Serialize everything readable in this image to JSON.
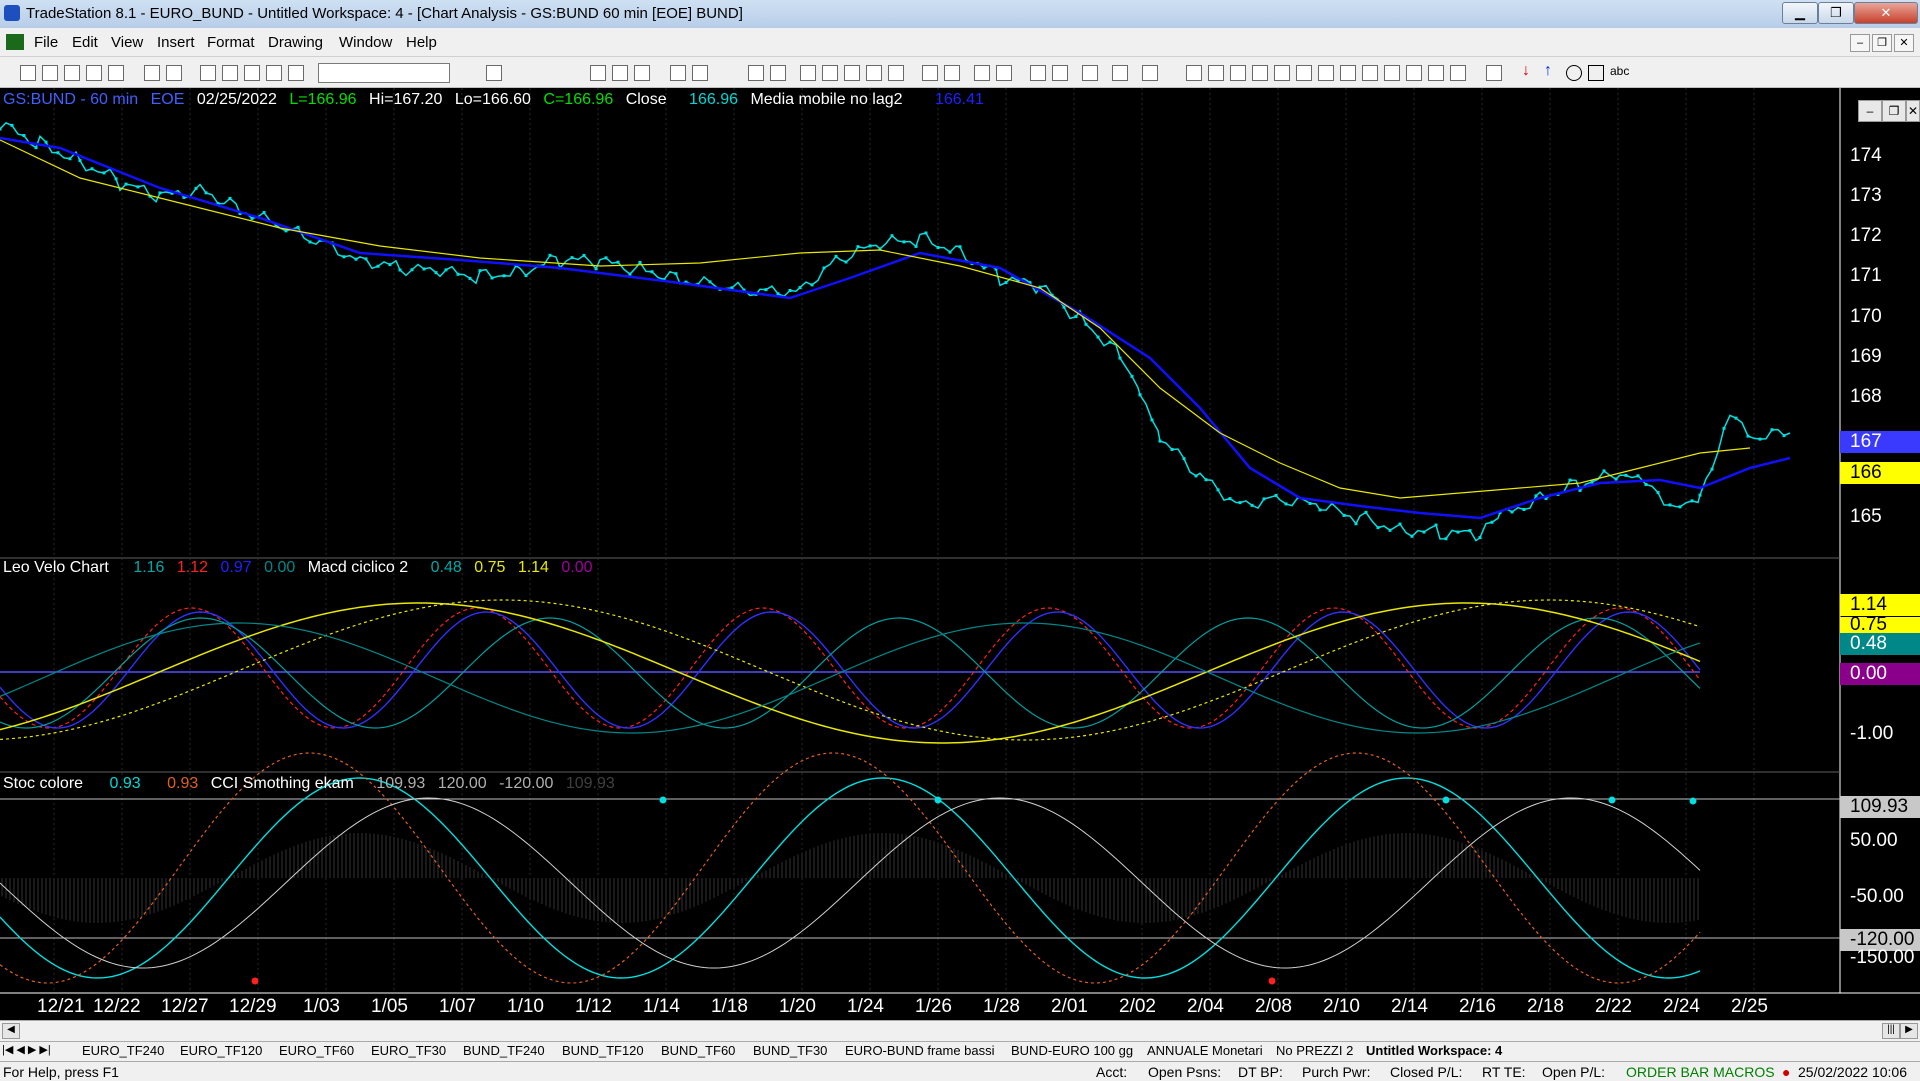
{
  "window": {
    "title": "TradeStation 8.1 - EURO_BUND - Untitled Workspace:  4 - [Chart Analysis - GS:BUND  60 min  [EOE] BUND]"
  },
  "menu": [
    "File",
    "Edit",
    "View",
    "Insert",
    "Format",
    "Drawing",
    "Window",
    "Help"
  ],
  "pane1": {
    "symbol": "GS:BUND - 60 min",
    "exchange": "EOE",
    "date": "02/25/2022",
    "last": "L=166.96",
    "high": "Hi=167.20",
    "low": "Lo=166.60",
    "close": "C=166.96",
    "close_label": "Close",
    "close_value": "166.96",
    "ma_label": "Media mobile no lag2",
    "ma_value": "166.41",
    "axis": [
      "174",
      "173",
      "172",
      "171",
      "170",
      "169",
      "168",
      "165"
    ],
    "tag_blue": "167",
    "tag_yellow": "166"
  },
  "pane2": {
    "title": "Leo Velo Chart",
    "v1": "1.16",
    "v2": "1.12",
    "v3": "0.97",
    "v4": "0.00",
    "title2": "Macd ciclico 2",
    "w1": "0.48",
    "w2": "0.75",
    "w3": "1.14",
    "w4": "0.00",
    "axis_low": "-1.00",
    "tags": [
      "1.14",
      "0.75",
      "0.48",
      "0.00"
    ]
  },
  "pane3": {
    "title": "Stoc colore",
    "v1": "0.93",
    "v2": "0.93",
    "title2": "CCI Smothing ekam",
    "w1": "109.93",
    "w2": "120.00",
    "w3": "-120.00",
    "w4": "109.93",
    "axis": [
      "50.00",
      "-50.00",
      "-150.00"
    ],
    "tag_top": "109.93",
    "tag_bottom": "-120.00"
  },
  "dates": [
    "12/21",
    "12/22",
    "12/27",
    "12/29",
    "1/03",
    "1/05",
    "1/07",
    "1/10",
    "1/12",
    "1/14",
    "1/18",
    "1/20",
    "1/24",
    "1/26",
    "1/28",
    "2/01",
    "2/02",
    "2/04",
    "2/08",
    "2/10",
    "2/14",
    "2/16",
    "2/18",
    "2/22",
    "2/24",
    "2/25"
  ],
  "tabs": [
    "EURO_TF240",
    "EURO_TF120",
    "EURO_TF60",
    "EURO_TF30",
    "BUND_TF240",
    "BUND_TF120",
    "BUND_TF60",
    "BUND_TF30",
    "EURO-BUND frame bassi",
    "BUND-EURO 100 gg",
    "ANNUALE Monetari",
    "No PREZZI 2",
    "Untitled Workspace:  4"
  ],
  "status": {
    "help": "For Help, press F1",
    "acct": "Acct:",
    "open_psns": "Open Psns:",
    "dt_bp": "DT BP:",
    "purch_pwr": "Purch Pwr:",
    "closed_pl": "Closed P/L:",
    "rt_te": "RT TE:",
    "open_pl": "Open P/L:",
    "macros": "ORDER BAR  MACROS",
    "datetime": "25/02/2022 10:06"
  },
  "colors": {
    "blue_ma": "#1010ff",
    "yellow_ma": "#e8e800",
    "cyan": "#00e0e0",
    "red": "#ff2020",
    "orange": "#e06020"
  }
}
